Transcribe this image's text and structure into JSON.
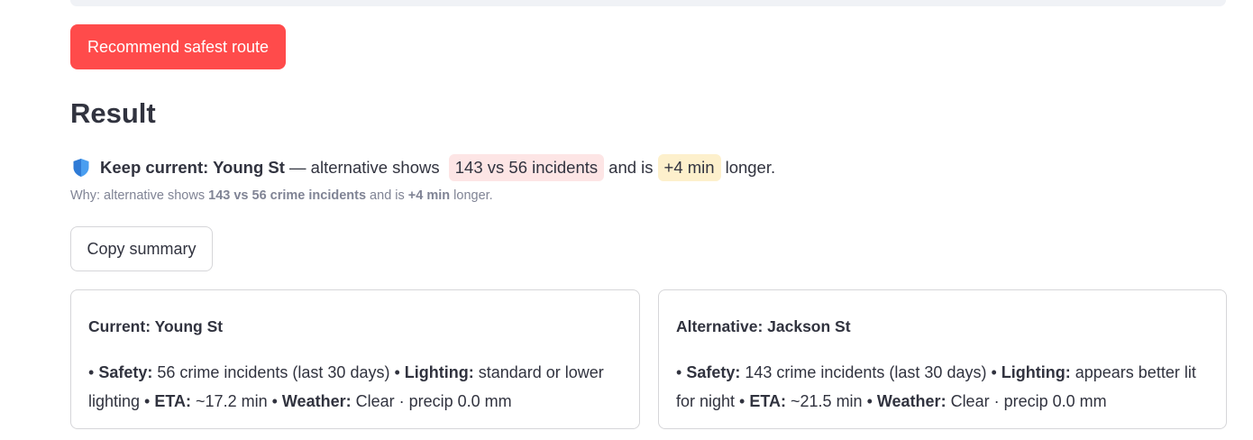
{
  "primary_button": {
    "label": "Recommend safest route"
  },
  "result": {
    "heading": "Result",
    "summary": {
      "icon": "shield-icon",
      "decision": "Keep current: Young St",
      "text_1": " — alternative shows ",
      "chip_incidents": "143 vs 56 incidents",
      "text_2": "and is",
      "chip_time": "+4 min",
      "text_3": "longer."
    },
    "why": {
      "prefix": "Why: alternative shows ",
      "incidents": "143 vs 56 crime incidents",
      "middle": " and is ",
      "time": "+4 min",
      "suffix": " longer."
    },
    "copy_button": {
      "label": "Copy summary"
    }
  },
  "cards": [
    {
      "title": "Current: Young St",
      "safety_label": "Safety:",
      "safety_value": " 56 crime incidents (last 30 days) • ",
      "lighting_label": "Lighting:",
      "lighting_value": " standard or lower lighting • ",
      "eta_label": "ETA:",
      "eta_value": " ~17.2 min • ",
      "weather_label": "Weather:",
      "weather_value": " Clear · precip 0.0 mm"
    },
    {
      "title": "Alternative: Jackson St",
      "safety_label": "Safety:",
      "safety_value": " 143 crime incidents (last 30 days) • ",
      "lighting_label": "Lighting:",
      "lighting_value": " appears better lit for night • ",
      "eta_label": "ETA:",
      "eta_value": " ~21.5 min • ",
      "weather_label": "Weather:",
      "weather_value": " Clear · precip 0.0 mm"
    }
  ],
  "colors": {
    "primary": "#ff4b4b",
    "chip_red": "#fde5e5",
    "chip_yellow": "#fdf0cc",
    "text": "#31333f",
    "muted": "#808495"
  }
}
